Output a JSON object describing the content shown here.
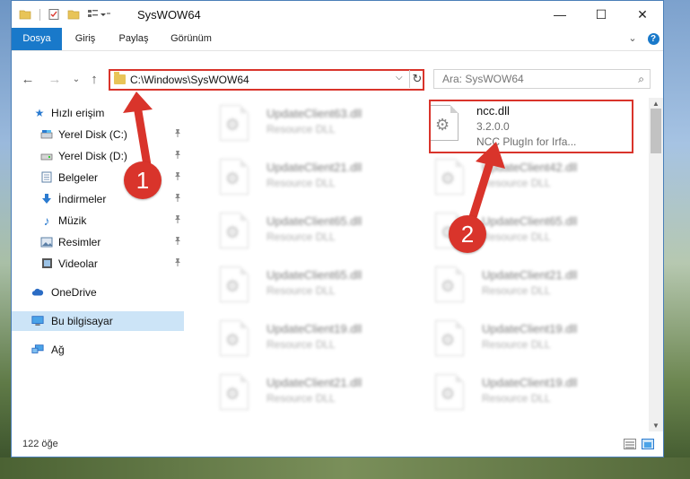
{
  "window": {
    "title": "SysWOW64",
    "minimize": "—",
    "maximize": "☐",
    "close": "✕"
  },
  "ribbon": {
    "tabs": [
      "Dosya",
      "Giriş",
      "Paylaş",
      "Görünüm"
    ],
    "expand": "⌄",
    "help": "?"
  },
  "nav": {
    "back": "←",
    "forward": "→",
    "recent": "⌄",
    "up": "↑",
    "address": "C:\\Windows\\SysWOW64",
    "address_dropdown": "⌵",
    "refresh": "↻",
    "search_placeholder": "Ara: SysWOW64",
    "search_icon": "⌕"
  },
  "sidebar": {
    "items": [
      {
        "label": "Hızlı erişim",
        "icon": "star-icon",
        "glyph": "★",
        "color": "#2b7bd0"
      },
      {
        "label": "Yerel Disk (C:)",
        "icon": "drive-icon",
        "glyph": "▬",
        "color": "#3a6ea5",
        "pinned": true
      },
      {
        "label": "Yerel Disk (D:)",
        "icon": "drive-icon",
        "glyph": "▬",
        "color": "#555555",
        "pinned": true
      },
      {
        "label": "Belgeler",
        "icon": "documents-icon",
        "glyph": "▤",
        "color": "#5b7fa6",
        "pinned": true
      },
      {
        "label": "İndirmeler",
        "icon": "download-icon",
        "glyph": "⬇",
        "color": "#2b7bd0",
        "pinned": true
      },
      {
        "label": "Müzik",
        "icon": "music-icon",
        "glyph": "♪",
        "color": "#2b7bd0",
        "pinned": true
      },
      {
        "label": "Resimler",
        "icon": "pictures-icon",
        "glyph": "▣",
        "color": "#5b7fa6",
        "pinned": true
      },
      {
        "label": "Videolar",
        "icon": "video-icon",
        "glyph": "▦",
        "color": "#444444",
        "pinned": true
      },
      {
        "label": "OneDrive",
        "icon": "cloud-icon",
        "glyph": "☁",
        "color": "#2b6cc4"
      },
      {
        "label": "Bu bilgisayar",
        "icon": "computer-icon",
        "glyph": "▭",
        "color": "#2b7bd0",
        "selected": true
      },
      {
        "label": "Ağ",
        "icon": "network-icon",
        "glyph": "▪",
        "color": "#2b7bd0"
      }
    ],
    "pin_glyph": "📌"
  },
  "files": {
    "highlighted": {
      "name": "ncc.dll",
      "version": "3.2.0.0",
      "description": "NCC PlugIn for Irfa..."
    },
    "left_column": [
      {
        "name": "UpdateClient63.dll",
        "type": "Resource DLL"
      },
      {
        "name": "UpdateClient21.dll",
        "type": "Resource DLL"
      },
      {
        "name": "UpdateClient65.dll",
        "type": "Resource DLL"
      },
      {
        "name": "UpdateClient65.dll",
        "type": "Resource DLL"
      },
      {
        "name": "UpdateClient19.dll",
        "type": "Resource DLL"
      },
      {
        "name": "UpdateClient21.dll",
        "type": "Resource DLL"
      }
    ],
    "right_column": [
      {
        "name": "UpdateClient42.dll",
        "type": "Resource DLL"
      },
      {
        "name": "UpdateClient65.dll",
        "type": "Resource DLL"
      },
      {
        "name": "UpdateClient21.dll",
        "type": "Resource DLL"
      },
      {
        "name": "UpdateClient19.dll",
        "type": "Resource DLL"
      },
      {
        "name": "UpdateClient19.dll",
        "type": "Resource DLL"
      }
    ]
  },
  "status": {
    "item_count": "122 öğe"
  },
  "annotations": {
    "step1": "1",
    "step2": "2"
  },
  "colors": {
    "accent": "#1979ca",
    "highlight_red": "#d9342b",
    "selection": "#cce4f7"
  }
}
